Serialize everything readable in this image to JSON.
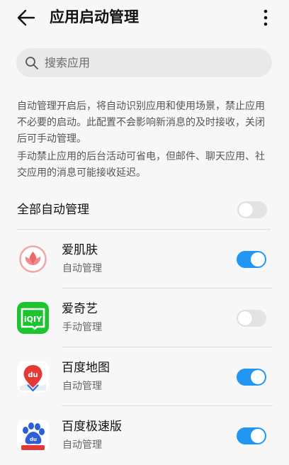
{
  "header": {
    "title": "应用启动管理",
    "back_icon": "arrow-left-icon",
    "more_icon": "more-vertical-icon"
  },
  "search": {
    "placeholder": "搜索应用",
    "value": "",
    "icon": "search-icon"
  },
  "description": {
    "para1": "自动管理开启后，将自动识别应用和使用场景，禁止应用不必要的启动。此配置不会影响新消息的及时接收，关闭后可手动管理。",
    "para2": "手动禁止应用的后台活动可省电，但邮件、聊天应用、社交应用的消息可能接收延迟。"
  },
  "all_auto": {
    "label": "全部自动管理",
    "enabled": false
  },
  "apps": [
    {
      "name": "爱肌肤",
      "status": "自动管理",
      "enabled": true,
      "icon": "lotus-icon"
    },
    {
      "name": "爱奇艺",
      "status": "手动管理",
      "enabled": false,
      "icon": "iqiyi-icon"
    },
    {
      "name": "百度地图",
      "status": "自动管理",
      "enabled": true,
      "icon": "map-pin-icon"
    },
    {
      "name": "百度极速版",
      "status": "自动管理",
      "enabled": true,
      "icon": "baidu-paw-icon"
    }
  ],
  "colors": {
    "toggle_on": "#2196f3",
    "toggle_off": "#e3e3e3",
    "background": "#f7f7f7"
  }
}
